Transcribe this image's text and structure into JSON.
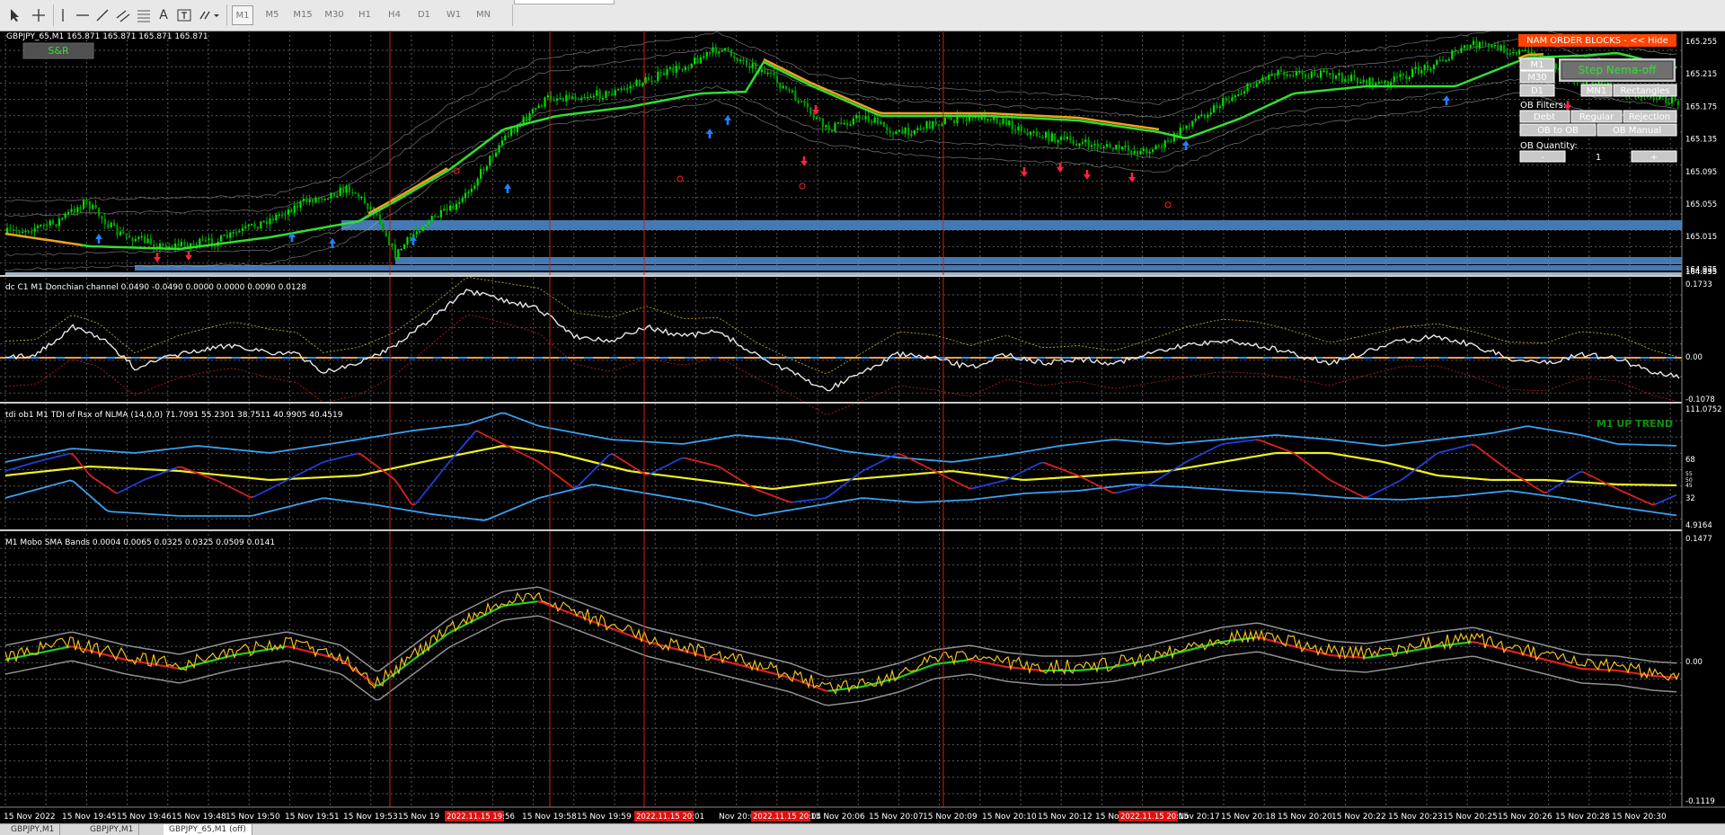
{
  "toolbar": {
    "timeframes": [
      "M1",
      "M5",
      "M15",
      "M30",
      "H1",
      "H4",
      "D1",
      "W1",
      "MN"
    ],
    "active_timeframe": "M1",
    "text_tool": "A"
  },
  "main_panel": {
    "header": "GBPJPY_65,M1  165.871 165.871 165.871 165.871",
    "sr_button": "S&R",
    "price_labels": [
      "165.255",
      "165.215",
      "165.175",
      "165.135",
      "165.095",
      "165.055",
      "165.015",
      "164.975",
      "164.935",
      "164.895"
    ]
  },
  "ob_panel": {
    "title": "NAM ORDER BLOCKS - << Hide",
    "step_button": "Step Nema-off",
    "tf_buttons": [
      "M1",
      "M30",
      "D1",
      "MN1"
    ],
    "rectangles_label": "Rectangles",
    "filters_label": "OB Filters:",
    "filter_buttons": [
      "Debt",
      "Regular",
      "Rejection",
      "OB to OB",
      "OB Manual"
    ],
    "quantity_label": "OB Quantity:",
    "minus": "-",
    "quantity_value": "1",
    "plus": "+"
  },
  "panel2": {
    "header": "dc C1 M1 Donchian channel 0.0490 -0.0490 0.0000 0.0000 0.0090 0.0128",
    "labels": [
      "0.1733",
      "0.00",
      "-0.1078"
    ]
  },
  "panel3": {
    "header": "tdi ob1 M1 TDI of Rsx of NLMA (14,0,0) 71.7091 55.2301 38.7511 40.9905 40.4519",
    "trend_label": "M1 UP TREND",
    "labels": [
      "111.0752",
      "68",
      "55",
      "50",
      "45",
      "32",
      "4.9164"
    ]
  },
  "panel4": {
    "header": "M1 Mobo SMA Bands 0.0004 0.0065 0.0325 0.0325 0.0509 0.0141",
    "labels": [
      "0.1477",
      "0.00",
      "-0.1119"
    ]
  },
  "time_axis": {
    "labels": [
      "15 Nov 2022",
      "15 Nov 19:45",
      "15 Nov 19:46",
      "15 Nov 19:48",
      "15 Nov 19:50",
      "15 Nov 19:51",
      "15 Nov 19:53",
      "15 Nov 19",
      "15 Nov 19:58",
      "15 Nov 19:59",
      "Nov 20:02",
      "15 Nov 20:06",
      "15 Nov 20:07",
      "15 Nov 20:09",
      "15 Nov 20:10",
      "15 Nov 20:12",
      "15 Nov 20:14",
      ":15",
      "15 Nov 20:17",
      "15 Nov 20:18",
      "15 Nov 20:20",
      "15 Nov 20:22",
      "15 Nov 20:23",
      "15 Nov 20:25",
      "15 Nov 20:26",
      "15 Nov 20:28",
      "15 Nov 20:30"
    ],
    "highlight_labels": [
      "2022.11.15 19:56",
      "2022.11.15 20:01",
      "2022.11.15 20:04",
      "2022.11.15 20:15"
    ]
  },
  "bottom_tabs": [
    "GBPJPY,M1",
    "GBPJPY,M1",
    "GBPJPY_65,M1 (off)"
  ],
  "colors": {
    "background": "#000000",
    "grid": "#5a5a5a",
    "candle": "#00d000",
    "ma_green": "#30e030",
    "ma_orange": "#f0a020",
    "ob_zone": "#4a86c8",
    "vline": "#d02010",
    "ob_title_bg": "#ff4400",
    "trend_label": "#109010"
  }
}
